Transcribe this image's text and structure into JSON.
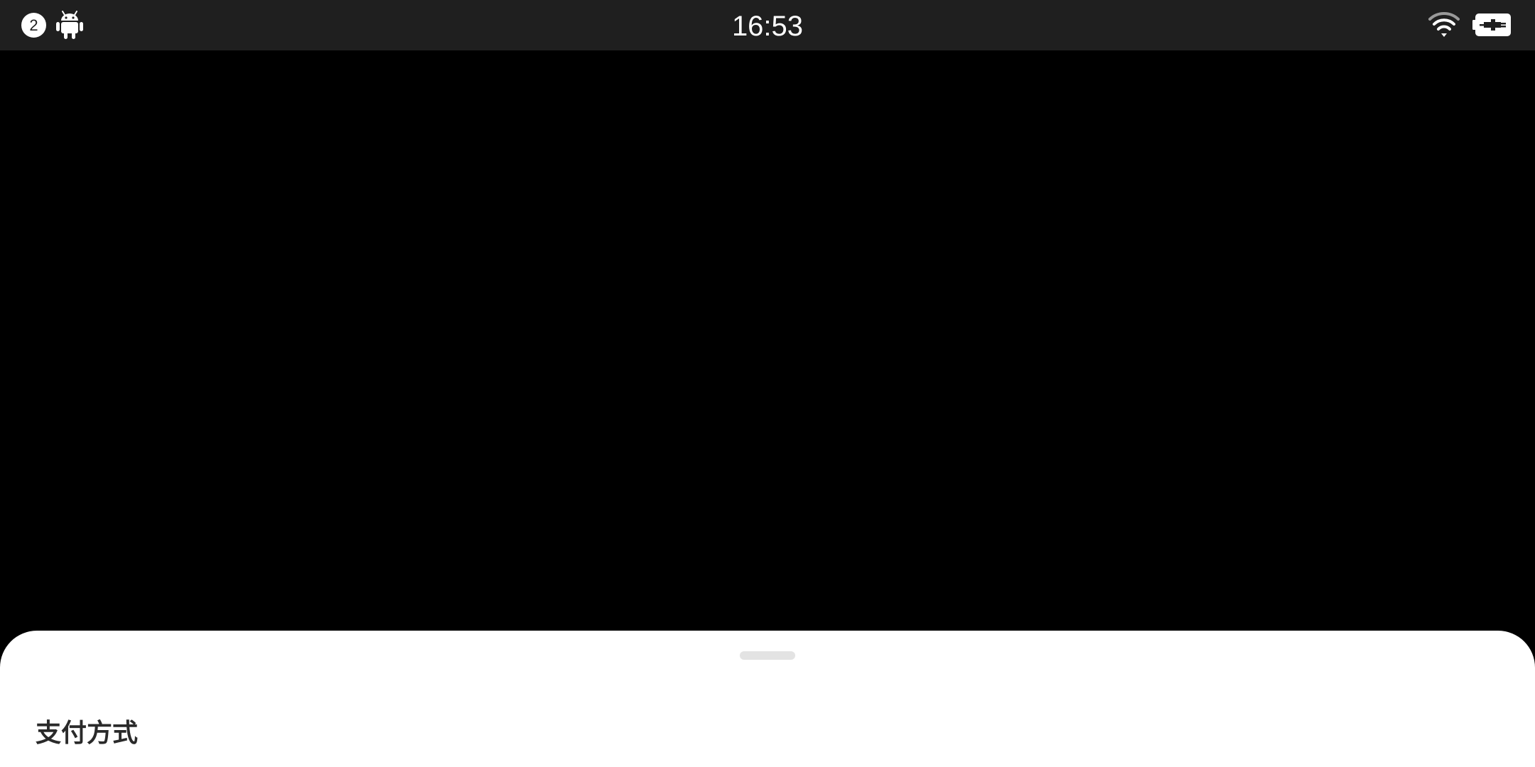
{
  "status_bar": {
    "notification_count": "2",
    "time": "16:53",
    "icons": [
      "android-icon",
      "wifi-icon",
      "battery-charging-icon"
    ]
  },
  "sheet": {
    "title": "支付方式"
  },
  "colors": {
    "status_bar_bg": "#1f1f1f",
    "content_bg": "#000000",
    "sheet_bg": "#ffffff",
    "handle": "#e3e3e3",
    "title_text": "#2a2a2a"
  }
}
